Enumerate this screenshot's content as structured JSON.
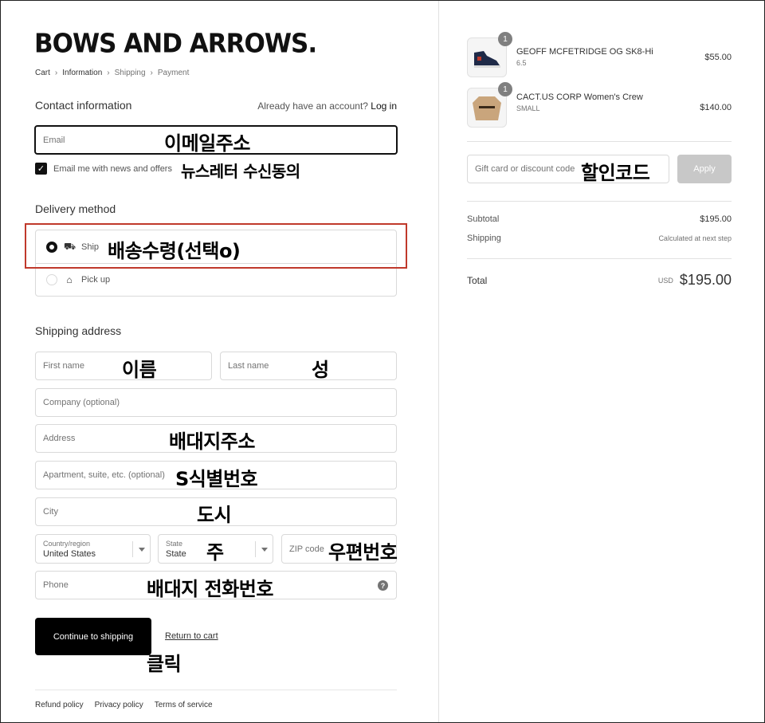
{
  "brand": {
    "logo": "BOWS AND ARROWS."
  },
  "breadcrumbs": {
    "cart": "Cart",
    "information": "Information",
    "shipping": "Shipping",
    "payment": "Payment"
  },
  "contact": {
    "title": "Contact information",
    "account_prompt": "Already have an account?",
    "login": "Log in",
    "email_placeholder": "Email",
    "email_annotation": "이메일주소",
    "newsletter_label": "Email me with news and offers",
    "newsletter_annotation": "뉴스레터 수신동의",
    "newsletter_checked": true
  },
  "delivery": {
    "title": "Delivery method",
    "ship_label": "Ship",
    "ship_annotation": "배송수령(선택o)",
    "pickup_label": "Pick up",
    "selected": "ship"
  },
  "shipping_address": {
    "title": "Shipping address",
    "first_name": "First name",
    "first_name_annotation": "이름",
    "last_name": "Last name",
    "last_name_annotation": "성",
    "company": "Company (optional)",
    "address": "Address",
    "address_annotation": "배대지주소",
    "apartment": "Apartment, suite, etc. (optional)",
    "apartment_annotation": "S식별번호",
    "city": "City",
    "city_annotation": "도시",
    "country_label": "Country/region",
    "country_value": "United States",
    "state_label": "State",
    "state_value": "State",
    "state_annotation": "주",
    "zip": "ZIP code",
    "zip_annotation": "우편번호",
    "phone": "Phone",
    "phone_annotation": "배대지 전화번호",
    "help_symbol": "?"
  },
  "actions": {
    "continue": "Continue to shipping",
    "continue_annotation": "클릭",
    "return": "Return to cart"
  },
  "footer": {
    "refund": "Refund policy",
    "privacy": "Privacy policy",
    "terms": "Terms of service"
  },
  "summary": {
    "items": [
      {
        "name": "GEOFF MCFETRIDGE OG SK8-Hi",
        "variant": "6.5",
        "price": "$55.00",
        "qty": "1"
      },
      {
        "name": "CACT.US CORP Women's Crew",
        "variant": "SMALL",
        "price": "$140.00",
        "qty": "1"
      }
    ],
    "discount_placeholder": "Gift card or discount code",
    "discount_annotation": "할인코드",
    "apply": "Apply",
    "subtotal_label": "Subtotal",
    "subtotal_value": "$195.00",
    "shipping_label": "Shipping",
    "shipping_value": "Calculated at next step",
    "total_label": "Total",
    "currency": "USD",
    "total_value": "$195.00"
  },
  "colors": {
    "primary": "#000000",
    "highlight_box": "#c0392b",
    "apply_disabled": "#c8c8c8"
  }
}
